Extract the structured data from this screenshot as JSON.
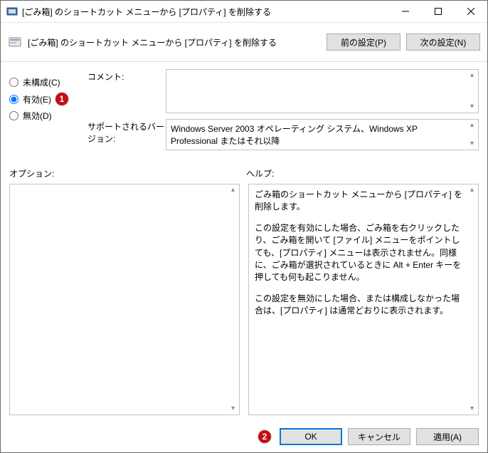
{
  "window": {
    "title": "[ごみ箱] のショートカット メニューから [プロパティ] を削除する"
  },
  "subheader": {
    "text": "[ごみ箱] のショートカット メニューから [プロパティ] を削除する",
    "prev": "前の設定(P)",
    "next": "次の設定(N)"
  },
  "radios": {
    "not_configured": "未構成(C)",
    "enabled": "有効(E)",
    "disabled": "無効(D)"
  },
  "form": {
    "comment_label": "コメント:",
    "supported_label": "サポートされるバージョン:",
    "supported_value": "Windows Server 2003 オペレーティング システム、Windows XP Professional またはそれ以降"
  },
  "sections": {
    "options_label": "オプション:",
    "help_label": "ヘルプ:"
  },
  "help": {
    "p1": "ごみ箱のショートカット メニューから [プロパティ] を削除します。",
    "p2": "この設定を有効にした場合、ごみ箱を右クリックしたり、ごみ箱を開いて [ファイル] メニューをポイントしても、[プロパティ] メニューは表示されません。同様に、ごみ箱が選択されているときに Alt + Enter キーを押しても何も起こりません。",
    "p3": "この設定を無効にした場合、または構成しなかった場合は、[プロパティ] は通常どおりに表示されます。"
  },
  "footer": {
    "ok": "OK",
    "cancel": "キャンセル",
    "apply": "適用(A)"
  },
  "markers": {
    "one": "1",
    "two": "2"
  }
}
